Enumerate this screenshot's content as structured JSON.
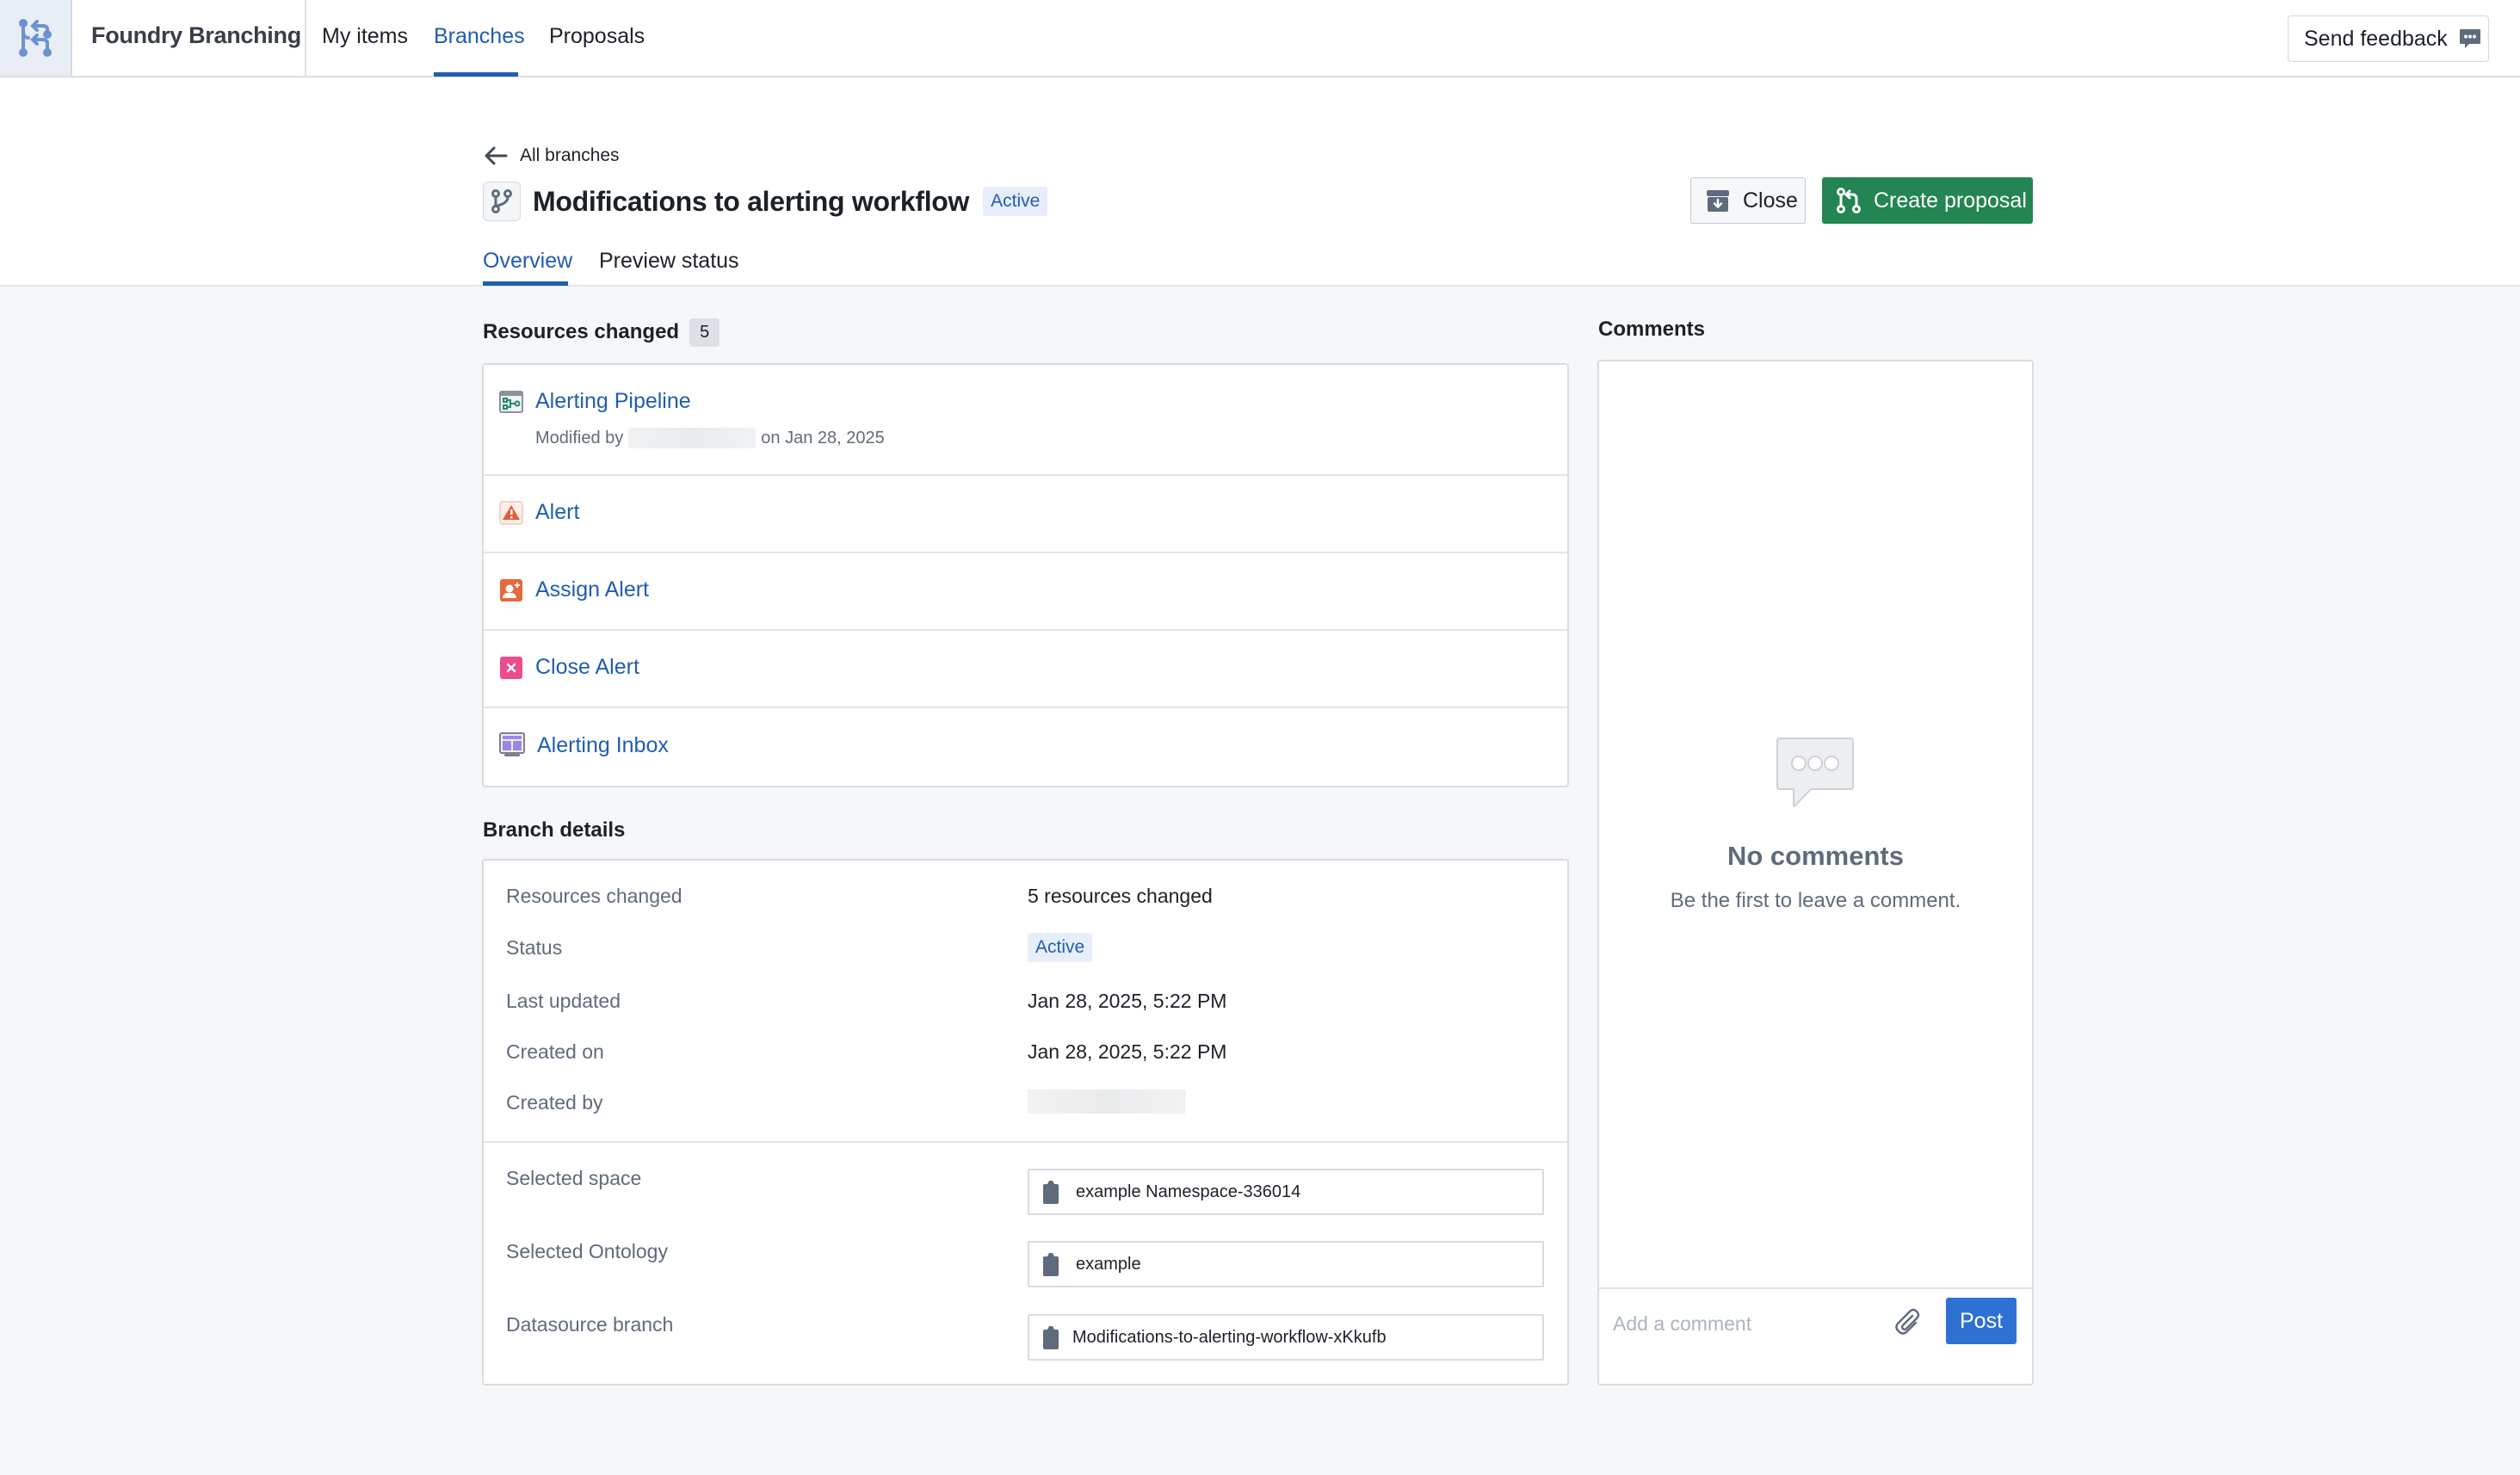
{
  "app": {
    "title": "Foundry Branching",
    "nav": [
      {
        "label": "My items",
        "active": false
      },
      {
        "label": "Branches",
        "active": true
      },
      {
        "label": "Proposals",
        "active": false
      }
    ],
    "feedback_label": "Send feedback"
  },
  "header": {
    "back_label": "All branches",
    "title": "Modifications to alerting workflow",
    "status": "Active",
    "close_label": "Close",
    "create_proposal_label": "Create proposal",
    "tabs": [
      {
        "label": "Overview",
        "active": true
      },
      {
        "label": "Preview status",
        "active": false
      }
    ]
  },
  "resources": {
    "title": "Resources changed",
    "count": "5",
    "items": [
      {
        "name": "Alerting Pipeline",
        "icon": "pipeline-icon",
        "modified_prefix": "Modified by",
        "modified_suffix": "on Jan 28, 2025"
      },
      {
        "name": "Alert",
        "icon": "warning-icon"
      },
      {
        "name": "Assign Alert",
        "icon": "assign-user-icon"
      },
      {
        "name": "Close Alert",
        "icon": "close-x-icon"
      },
      {
        "name": "Alerting Inbox",
        "icon": "workshop-app-icon"
      }
    ]
  },
  "details": {
    "title": "Branch details",
    "rows": [
      {
        "label": "Resources changed",
        "value": "5 resources changed"
      },
      {
        "label": "Status",
        "value": "Active"
      },
      {
        "label": "Last updated",
        "value": "Jan 28, 2025, 5:22 PM"
      },
      {
        "label": "Created on",
        "value": "Jan 28, 2025, 5:22 PM"
      },
      {
        "label": "Created by",
        "value": ""
      }
    ],
    "fields": [
      {
        "label": "Selected space",
        "value": "example Namespace-336014"
      },
      {
        "label": "Selected Ontology",
        "value": "example"
      },
      {
        "label": "Datasource branch",
        "value": "Modifications-to-alerting-workflow-xKkufb"
      }
    ]
  },
  "comments": {
    "title": "Comments",
    "empty_title": "No comments",
    "empty_subtitle": "Be the first to leave a comment.",
    "placeholder": "Add a comment",
    "post_label": "Post"
  },
  "colors": {
    "accent": "#215db0",
    "create_button": "#238551",
    "post_button": "#2d72d2"
  }
}
